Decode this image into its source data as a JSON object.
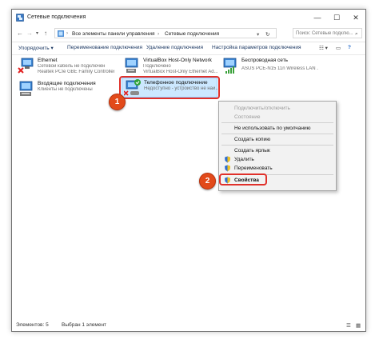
{
  "window": {
    "title": "Сетевые подключения",
    "minimize": "—",
    "maximize": "☐",
    "close": "✕"
  },
  "address": {
    "crumbs": [
      "Все элементы панели управления",
      "›",
      "Сетевые подключения"
    ],
    "search_placeholder": "Поиск: Сетевые подклю..."
  },
  "toolbar": {
    "organize": "Упорядочить ▾",
    "rename": "Переименование подключения",
    "delete": "Удаление подключения",
    "settings": "Настройка параметров подключения"
  },
  "connections": [
    {
      "name": "Ethernet",
      "status": "Сетевой кабель не подключен",
      "device": "Realtek PCIe GBE Family Controller",
      "icon": "ethernet-disconnected-icon"
    },
    {
      "name": "VirtualBox Host-Only Network",
      "status": "Подключено",
      "device": "VirtualBox Host-Only Ethernet Ad...",
      "icon": "ethernet-icon"
    },
    {
      "name": "Беспроводная сеть",
      "status": "",
      "device": "ASUS PCE-N15 11n Wireless LAN ...",
      "icon": "wireless-icon"
    },
    {
      "name": "Входящие подключения",
      "status": "Клиенты не подключены",
      "device": "",
      "icon": "incoming-connection-icon"
    },
    {
      "name": "Телефонное подключение",
      "status": "Недоступно - устройство не най...",
      "device": "",
      "icon": "dialup-icon"
    }
  ],
  "context_menu": {
    "items": [
      "Подключить/отключить",
      "Состояние",
      "Не использовать по умолчанию",
      "Создать копию",
      "Создать ярлык",
      "Удалить",
      "Переименовать",
      "Свойства"
    ]
  },
  "badges": [
    "1",
    "2"
  ],
  "statusbar": {
    "count": "Элементов: 5",
    "selected": "Выбран 1 элемент"
  },
  "colors": {
    "accent": "#1e3a64",
    "selection": "#cce8ff",
    "highlight": "#e0302a",
    "badge": "#e24a1a"
  }
}
